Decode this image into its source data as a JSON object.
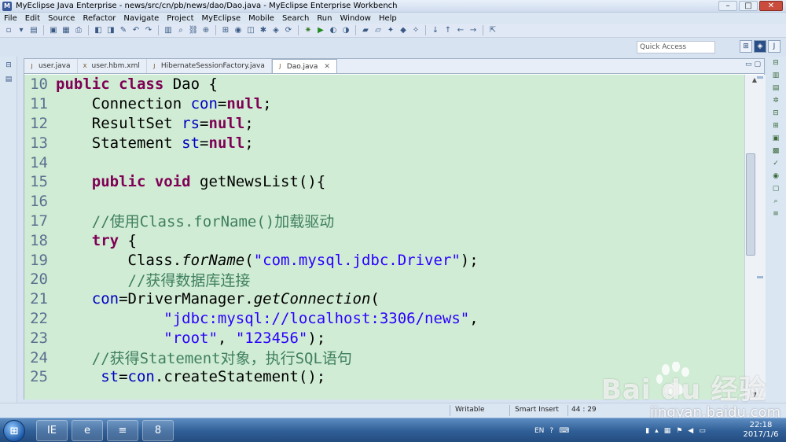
{
  "window": {
    "title": "MyEclipse Java Enterprise - news/src/cn/pb/news/dao/Dao.java - MyEclipse Enterprise Workbench",
    "controls": [
      "–",
      "□",
      "✕"
    ]
  },
  "menu": [
    "File",
    "Edit",
    "Source",
    "Refactor",
    "Navigate",
    "Project",
    "MyEclipse",
    "Mobile",
    "Search",
    "Run",
    "Window",
    "Help"
  ],
  "quick_access": {
    "placeholder": "Quick Access"
  },
  "editor": {
    "tabs": [
      {
        "label": "user.java",
        "active": false
      },
      {
        "label": "user.hbm.xml",
        "active": false
      },
      {
        "label": "HibernateSessionFactory.java",
        "active": false
      },
      {
        "label": "Dao.java",
        "active": true
      }
    ],
    "lines": [
      {
        "num": "10",
        "marker": false,
        "tokens": [
          [
            "kw",
            "public class"
          ],
          [
            "txt",
            " Dao {"
          ]
        ]
      },
      {
        "num": "11",
        "marker": false,
        "tokens": [
          [
            "txt",
            "    Connection "
          ],
          [
            "fld",
            "con"
          ],
          [
            "txt",
            "="
          ],
          [
            "kw",
            "null"
          ],
          [
            "txt",
            ";"
          ]
        ]
      },
      {
        "num": "12",
        "marker": false,
        "tokens": [
          [
            "txt",
            "    ResultSet "
          ],
          [
            "fld",
            "rs"
          ],
          [
            "txt",
            "="
          ],
          [
            "kw",
            "null"
          ],
          [
            "txt",
            ";"
          ]
        ]
      },
      {
        "num": "13",
        "marker": false,
        "tokens": [
          [
            "txt",
            "    Statement "
          ],
          [
            "fld",
            "st"
          ],
          [
            "txt",
            "="
          ],
          [
            "kw",
            "null"
          ],
          [
            "txt",
            ";"
          ]
        ]
      },
      {
        "num": "14",
        "marker": false,
        "tokens": [
          [
            "txt",
            ""
          ]
        ]
      },
      {
        "num": "15",
        "marker": true,
        "tokens": [
          [
            "txt",
            "    "
          ],
          [
            "kw",
            "public void"
          ],
          [
            "txt",
            " getNewsList(){"
          ]
        ]
      },
      {
        "num": "16",
        "marker": true,
        "tokens": [
          [
            "txt",
            ""
          ]
        ]
      },
      {
        "num": "17",
        "marker": true,
        "tokens": [
          [
            "cmt",
            "    //使用Class.forName()加载驱动"
          ]
        ]
      },
      {
        "num": "18",
        "marker": true,
        "tokens": [
          [
            "txt",
            "    "
          ],
          [
            "kw",
            "try"
          ],
          [
            "txt",
            " {"
          ]
        ]
      },
      {
        "num": "19",
        "marker": true,
        "tokens": [
          [
            "txt",
            "        Class."
          ],
          [
            "ital",
            "forName"
          ],
          [
            "txt",
            "("
          ],
          [
            "str",
            "\"com.mysql.jdbc.Driver\""
          ],
          [
            "txt",
            ");"
          ]
        ]
      },
      {
        "num": "20",
        "marker": true,
        "tokens": [
          [
            "cmt",
            "        //获得数据库连接"
          ]
        ]
      },
      {
        "num": "21",
        "marker": true,
        "tokens": [
          [
            "txt",
            "    "
          ],
          [
            "fld",
            "con"
          ],
          [
            "txt",
            "=DriverManager."
          ],
          [
            "ital",
            "getConnection"
          ],
          [
            "txt",
            "("
          ]
        ]
      },
      {
        "num": "22",
        "marker": true,
        "tokens": [
          [
            "txt",
            "            "
          ],
          [
            "str",
            "\"jdbc:mysql://localhost:3306/news\""
          ],
          [
            "txt",
            ","
          ]
        ]
      },
      {
        "num": "23",
        "marker": true,
        "tokens": [
          [
            "txt",
            "            "
          ],
          [
            "str",
            "\"root\""
          ],
          [
            "txt",
            ", "
          ],
          [
            "str",
            "\"123456\""
          ],
          [
            "txt",
            ");"
          ]
        ]
      },
      {
        "num": "24",
        "marker": true,
        "tokens": [
          [
            "cmt",
            "    //获得Statement对象，执行SQL语句"
          ]
        ]
      },
      {
        "num": "25",
        "marker": true,
        "tokens": [
          [
            "txt",
            "     "
          ],
          [
            "fld",
            "st"
          ],
          [
            "txt",
            "="
          ],
          [
            "fld",
            "con"
          ],
          [
            "txt",
            ".createStatement();"
          ]
        ]
      }
    ]
  },
  "status": {
    "writable": "Writable",
    "insert_mode": "Smart Insert",
    "position": "44 : 29"
  },
  "taskbar": {
    "apps": [
      "IE",
      "e",
      "≡",
      "8"
    ],
    "tray_lang": "EN",
    "time": "22:18",
    "date": "2017/1/6"
  },
  "watermark": {
    "logo": "Bai du 经验",
    "url": "jingyan.baidu.com"
  },
  "colors": {
    "code_bg": "#d0ecd4",
    "keyword": "#7f0055",
    "field": "#0000c0",
    "string": "#2a00ff",
    "comment": "#3f7f5f"
  }
}
